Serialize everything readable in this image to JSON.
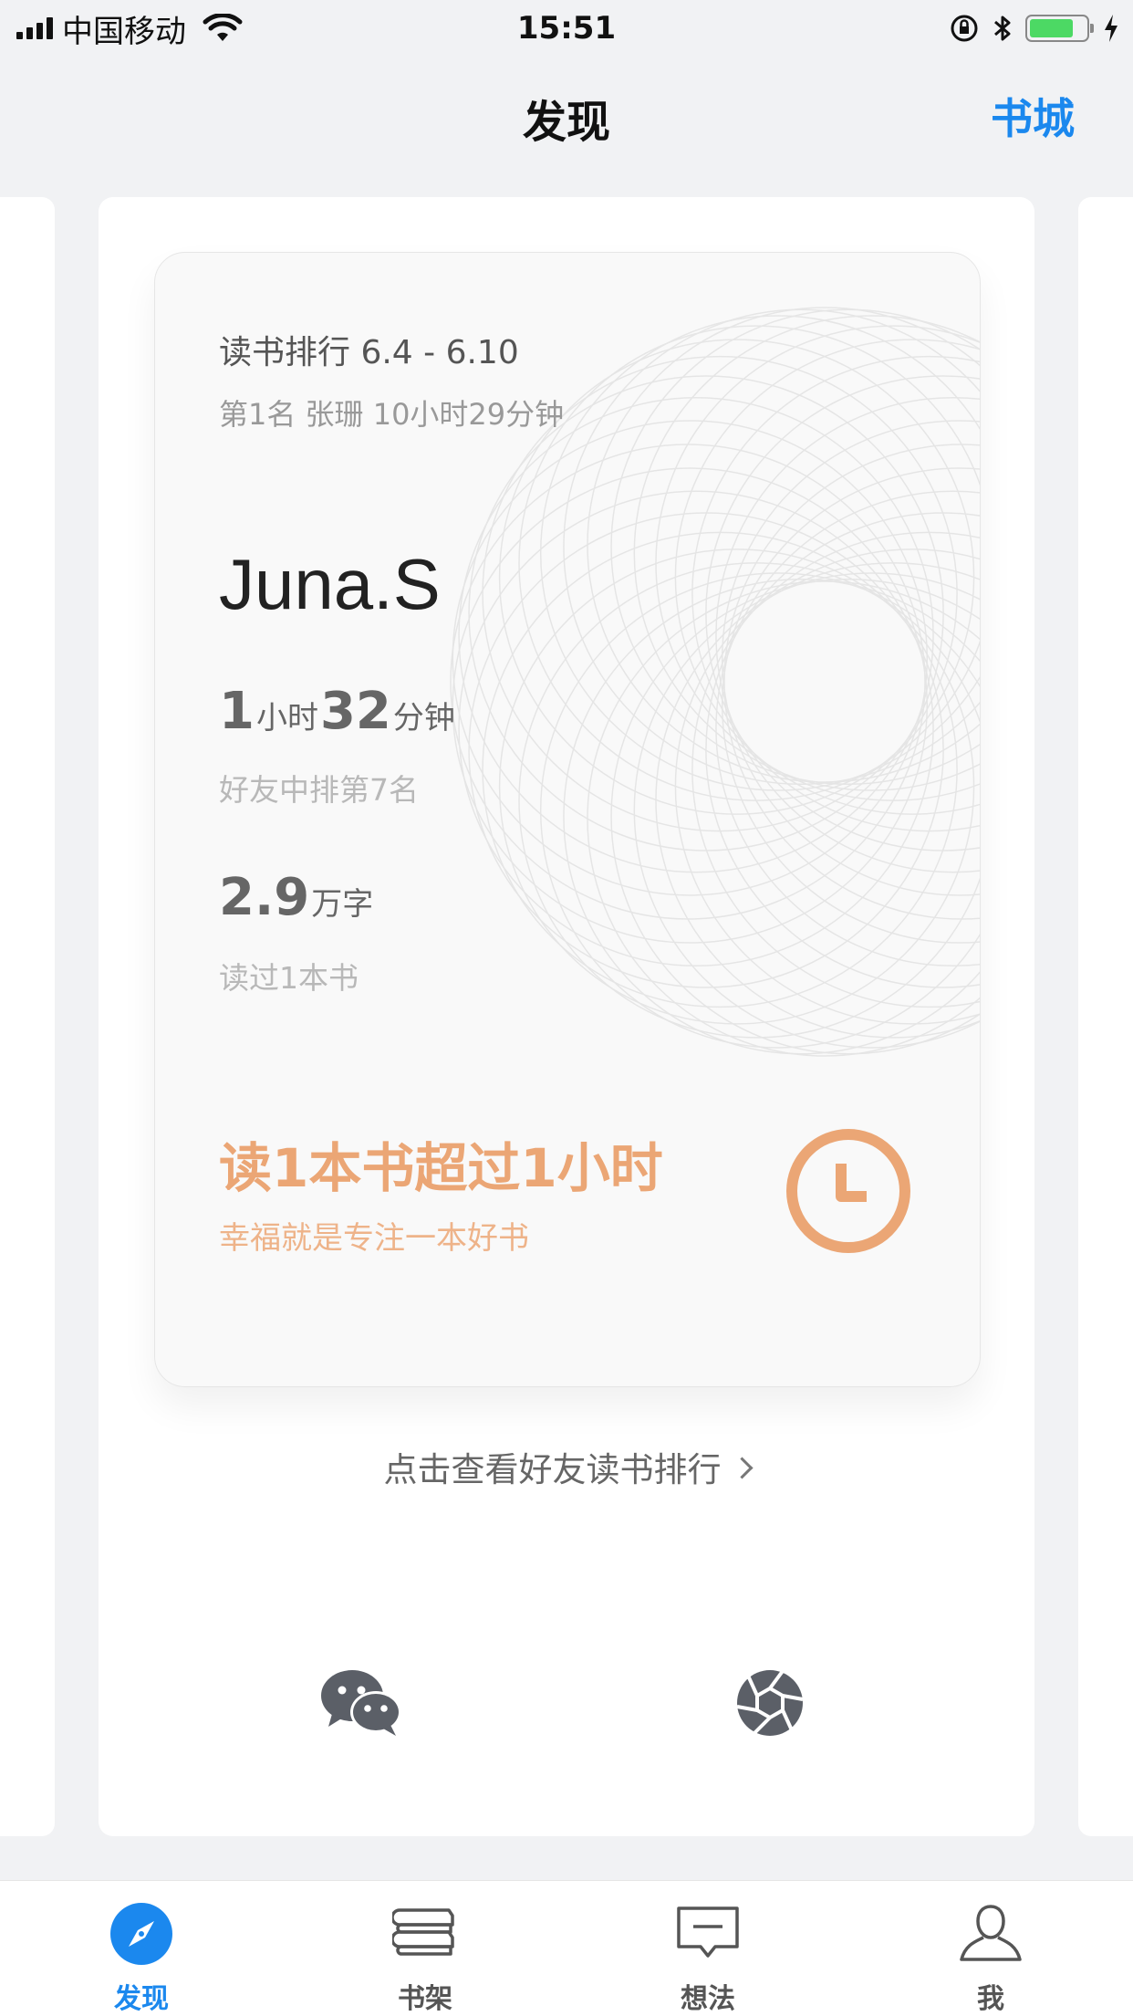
{
  "status_bar": {
    "carrier": "中国移动",
    "time": "15:51",
    "battery_level": 0.82,
    "icons": [
      "signal-icon",
      "wifi-icon",
      "orientation-lock-icon",
      "bluetooth-icon",
      "battery-icon",
      "charging-icon"
    ]
  },
  "nav": {
    "title": "发现",
    "right_link": "书城"
  },
  "card": {
    "week_label": "读书排行 6.4 - 6.10",
    "first_place": "第1名 张珊 10小时29分钟",
    "user_name": "Juna.S",
    "hours_value": "1",
    "hours_unit": "小时",
    "minutes_value": "32",
    "minutes_unit": "分钟",
    "friends_rank": "好友中排第7名",
    "words_value": "2.9",
    "words_unit": "万字",
    "books_read": "读过1本书",
    "achievement_title": "读1本书超过1小时",
    "achievement_subtitle": "幸福就是专注一本好书",
    "accent_color": "#eba675"
  },
  "view_ranking_link": "点击查看好友读书排行",
  "share": {
    "wechat_icon": "wechat-icon",
    "moments_icon": "moments-icon"
  },
  "tabbar": {
    "active_color": "#1b88ee",
    "items": [
      {
        "label": "发现",
        "icon": "compass-icon",
        "active": true
      },
      {
        "label": "书架",
        "icon": "bookshelf-icon",
        "active": false
      },
      {
        "label": "想法",
        "icon": "comment-icon",
        "active": false
      },
      {
        "label": "我",
        "icon": "person-icon",
        "active": false
      }
    ]
  }
}
